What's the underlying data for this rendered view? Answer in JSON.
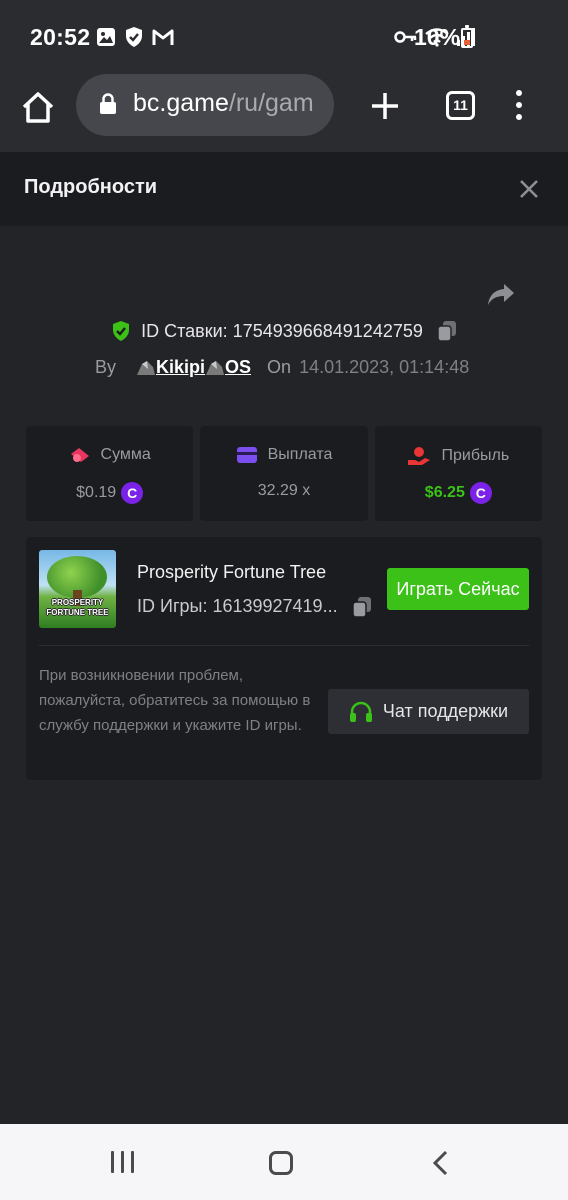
{
  "status_bar": {
    "time": "20:52",
    "battery": "10%",
    "battery_level": 0.1,
    "icons": [
      "gallery-icon",
      "shield-icon",
      "gmail-icon",
      "key-icon",
      "wifi-icon",
      "signal-icon",
      "battery-icon"
    ]
  },
  "browser": {
    "url_host": "bc.game",
    "url_path": "/ru/gam",
    "tab_count": "11"
  },
  "modal": {
    "title": "Подробности"
  },
  "bet": {
    "id_label": "ID Ставки:",
    "id_value": "1754939668491242759",
    "by_label": "By",
    "user": "Kikipi",
    "user_suffix": "OS",
    "on_label": "On",
    "date": "14.01.2023, 01:14:48"
  },
  "stats": [
    {
      "label": "Сумма",
      "value": "$0.19",
      "coin": "C",
      "icon": "chips-icon",
      "color": "#e8375f"
    },
    {
      "label": "Выплата",
      "value": "32.29 x",
      "icon": "card-icon",
      "color": "#7b4ef0"
    },
    {
      "label": "Прибыль",
      "value": "$6.25",
      "coin": "C",
      "icon": "profit-hand-icon",
      "color": "#e83535"
    }
  ],
  "game": {
    "thumb_line1": "PROSPERITY",
    "thumb_line2": "FORTUNE TREE",
    "name": "Prosperity Fortune Tree",
    "id_text": "ID Игры: 16139927419...",
    "play_label": "Играть Сейчас",
    "help_text": "При возникновении проблем, пожалуйста, обратитесь за помощью в службу поддержки и укажите ID игры.",
    "support_label": "Чат поддержки"
  },
  "colors": {
    "accent_green": "#3bc117",
    "coin_purple": "#7b22e8",
    "background": "#232428",
    "panel": "#1b1c1f"
  }
}
